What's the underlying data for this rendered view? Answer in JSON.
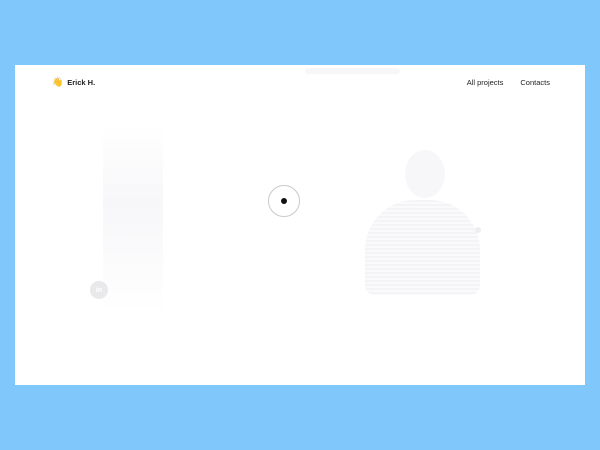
{
  "brand": {
    "emoji": "👋",
    "name": "Erick H."
  },
  "nav": {
    "items": [
      "All projects",
      "Contacts"
    ]
  },
  "social": {
    "label": "in"
  },
  "colors": {
    "background": "#80c8fc",
    "surface": "#ffffff",
    "text": "#222222",
    "cursor": "#111111"
  }
}
